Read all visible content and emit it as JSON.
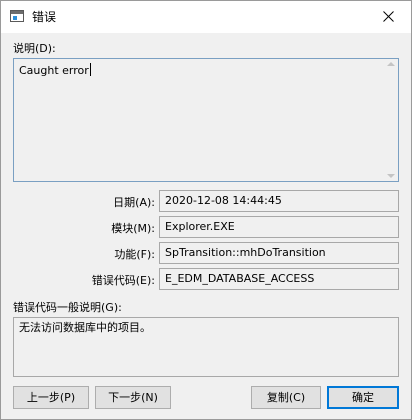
{
  "window": {
    "title": "错误",
    "close_glyph": "close-icon"
  },
  "description": {
    "label": "说明(D):",
    "text": "Caught error"
  },
  "fields": {
    "date": {
      "label": "日期(A):",
      "value": "2020-12-08 14:44:45"
    },
    "module": {
      "label": "模块(M):",
      "value": "Explorer.EXE"
    },
    "function": {
      "label": "功能(F):",
      "value": "SpTransition::mhDoTransition"
    },
    "error_code": {
      "label": "错误代码(E):",
      "value": "E_EDM_DATABASE_ACCESS"
    }
  },
  "general_description": {
    "label": "错误代码一般说明(G):",
    "text": "无法访问数据库中的项目。"
  },
  "buttons": {
    "prev": "上一步(P)",
    "next": "下一步(N)",
    "copy": "复制(C)",
    "ok": "确定"
  },
  "colors": {
    "focus_border": "#0078d7",
    "background": "#f0f0f0"
  }
}
